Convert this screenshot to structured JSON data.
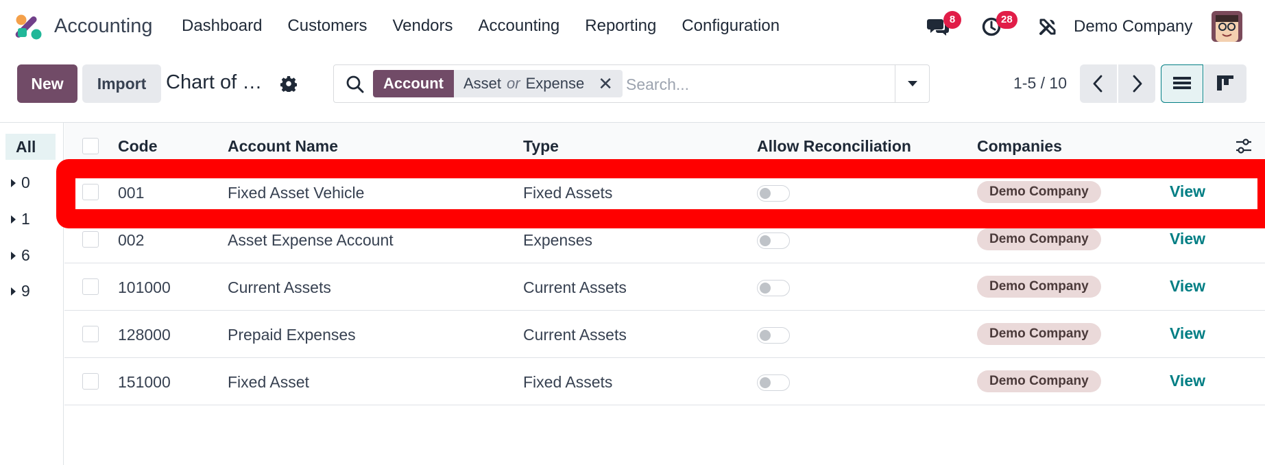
{
  "navbar": {
    "app_name": "Accounting",
    "menu": [
      "Dashboard",
      "Customers",
      "Vendors",
      "Accounting",
      "Reporting",
      "Configuration"
    ],
    "messages_count": "8",
    "activities_count": "28",
    "company": "Demo Company"
  },
  "control_panel": {
    "new_label": "New",
    "import_label": "Import",
    "title": "Chart of …",
    "search": {
      "facet_label": "Account",
      "facet_value_1": "Asset",
      "facet_or": "or",
      "facet_value_2": "Expense",
      "placeholder": "Search..."
    },
    "pager": "1-5 / 10"
  },
  "sidepanel": {
    "all_label": "All",
    "groups": [
      "0",
      "1",
      "6",
      "9"
    ]
  },
  "table": {
    "columns": [
      "Code",
      "Account Name",
      "Type",
      "Allow Reconciliation",
      "Companies"
    ],
    "rows": [
      {
        "code": "001",
        "name": "Fixed Asset Vehicle",
        "type": "Fixed Assets",
        "reconcile": false,
        "company": "Demo Company",
        "action": "View"
      },
      {
        "code": "002",
        "name": "Asset Expense Account",
        "type": "Expenses",
        "reconcile": false,
        "company": "Demo Company",
        "action": "View"
      },
      {
        "code": "101000",
        "name": "Current Assets",
        "type": "Current Assets",
        "reconcile": false,
        "company": "Demo Company",
        "action": "View"
      },
      {
        "code": "128000",
        "name": "Prepaid Expenses",
        "type": "Current Assets",
        "reconcile": false,
        "company": "Demo Company",
        "action": "View"
      },
      {
        "code": "151000",
        "name": "Fixed Asset",
        "type": "Fixed Assets",
        "reconcile": false,
        "company": "Demo Company",
        "action": "View"
      }
    ]
  },
  "colors": {
    "brand": "#714b67",
    "link": "#017e84",
    "badge": "#e11d48",
    "highlight": "#ff0000",
    "tag": "#ead9d9"
  },
  "icons": [
    "odoo-logo-icon",
    "chat-icon",
    "clock-icon",
    "tools-icon",
    "avatar",
    "gear-icon",
    "search-icon",
    "caret-down-icon",
    "chevron-left-icon",
    "chevron-right-icon",
    "list-view-icon",
    "kanban-view-icon",
    "caret-right-icon",
    "optional-columns-icon"
  ]
}
